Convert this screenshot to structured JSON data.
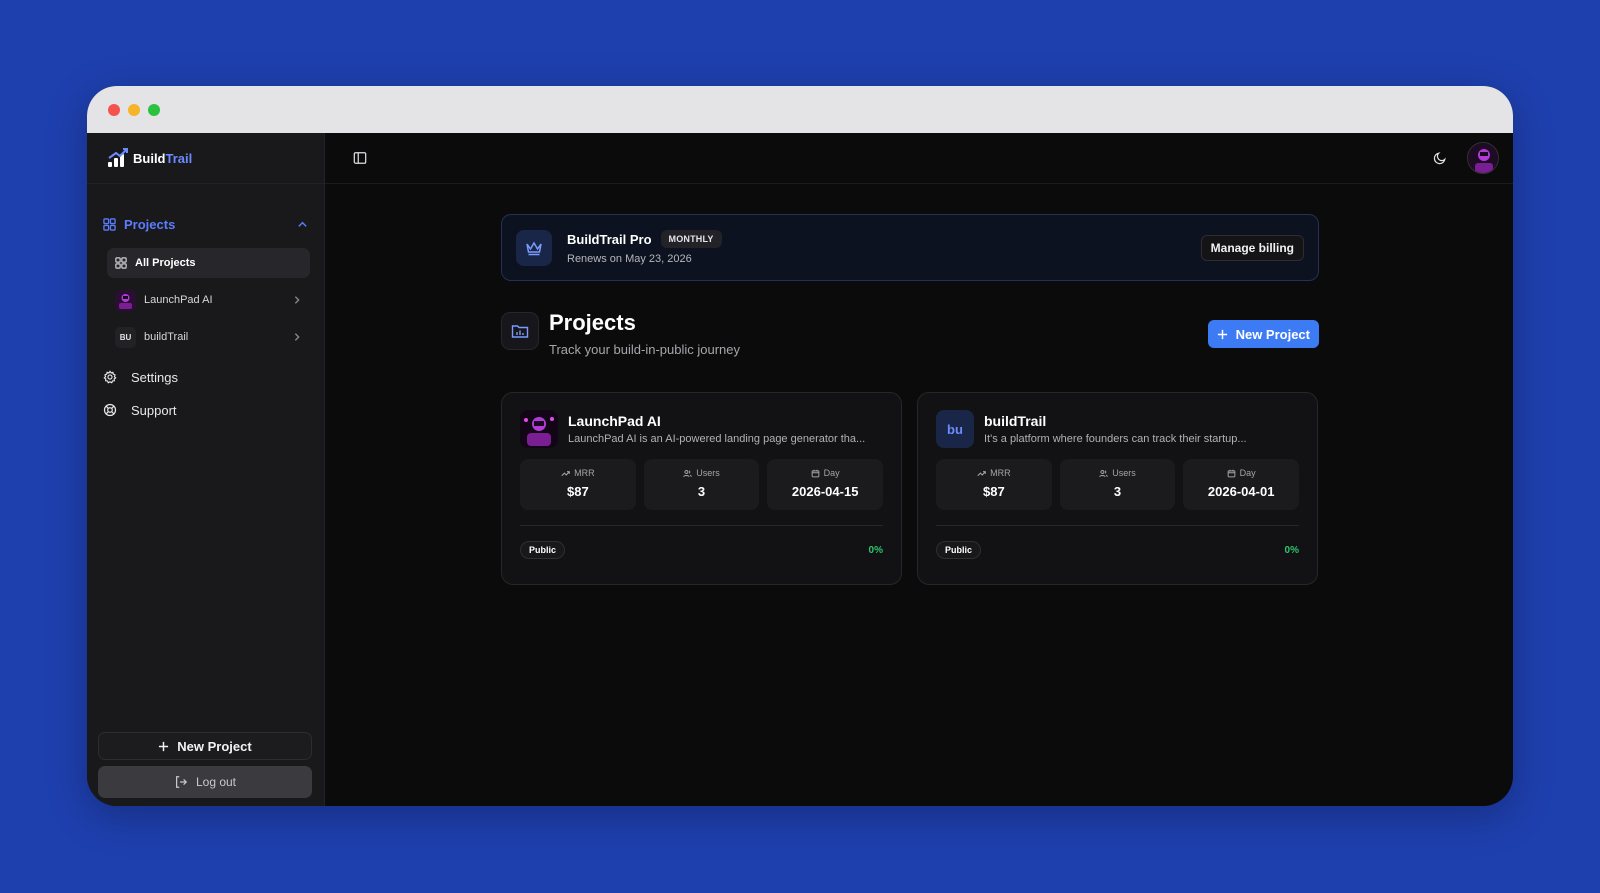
{
  "brand": {
    "name_part1": "Build",
    "name_part2": "Trail"
  },
  "sidebar": {
    "section_label": "Projects",
    "items": [
      {
        "label": "All Projects"
      },
      {
        "label": "LaunchPad AI"
      },
      {
        "label": "buildTrail",
        "badge": "BU"
      }
    ],
    "settings_label": "Settings",
    "support_label": "Support",
    "new_project_label": "New Project",
    "logout_label": "Log out"
  },
  "banner": {
    "title": "BuildTrail Pro",
    "badge": "MONTHLY",
    "subtitle": "Renews on May 23, 2026",
    "button": "Manage billing"
  },
  "projects": {
    "title": "Projects",
    "subtitle": "Track your build-in-public journey",
    "new_button": "New Project",
    "cards": [
      {
        "name": "LaunchPad AI",
        "description": "LaunchPad AI is an AI-powered landing page generator tha...",
        "stats": [
          {
            "label": "MRR",
            "value": "$87"
          },
          {
            "label": "Users",
            "value": "3"
          },
          {
            "label": "Day",
            "value": "2026-04-15"
          }
        ],
        "visibility": "Public",
        "progress": "0%"
      },
      {
        "name": "buildTrail",
        "badge": "bu",
        "description": "It's a platform where founders can track their startup...",
        "stats": [
          {
            "label": "MRR",
            "value": "$87"
          },
          {
            "label": "Users",
            "value": "3"
          },
          {
            "label": "Day",
            "value": "2026-04-01"
          }
        ],
        "visibility": "Public",
        "progress": "0%"
      }
    ]
  },
  "colors": {
    "accent": "#3d7bf5",
    "success": "#2fc56d",
    "background": "#1e3fae"
  }
}
